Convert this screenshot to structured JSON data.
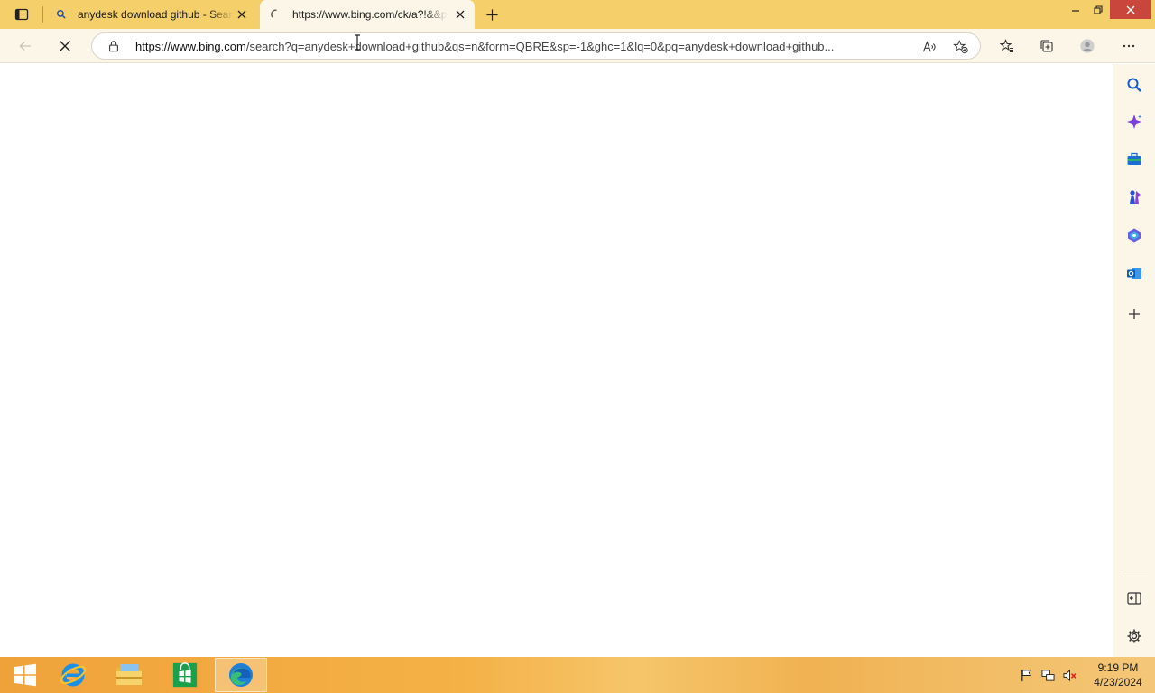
{
  "tabs": [
    {
      "title": "anydesk download github - Search",
      "favicon": "search-icon",
      "active": false
    },
    {
      "title": "https://www.bing.com/ck/a?!&&p=",
      "favicon": "loading-spinner-icon",
      "active": true
    }
  ],
  "address_bar": {
    "url_host": "https://www.bing.com",
    "url_path": "/search?q=anydesk+download+github&qs=n&form=QBRE&sp=-1&ghc=1&lq=0&pq=anydesk+download+github...",
    "read_aloud_label": "A̅"
  },
  "taskbar": {
    "time": "9:19 PM",
    "date": "4/23/2024"
  },
  "colors": {
    "tab_strip": "#f4cf6a",
    "toolbar": "#fbf6e8",
    "close_button": "#c9463d",
    "taskbar": "#f4b146"
  }
}
